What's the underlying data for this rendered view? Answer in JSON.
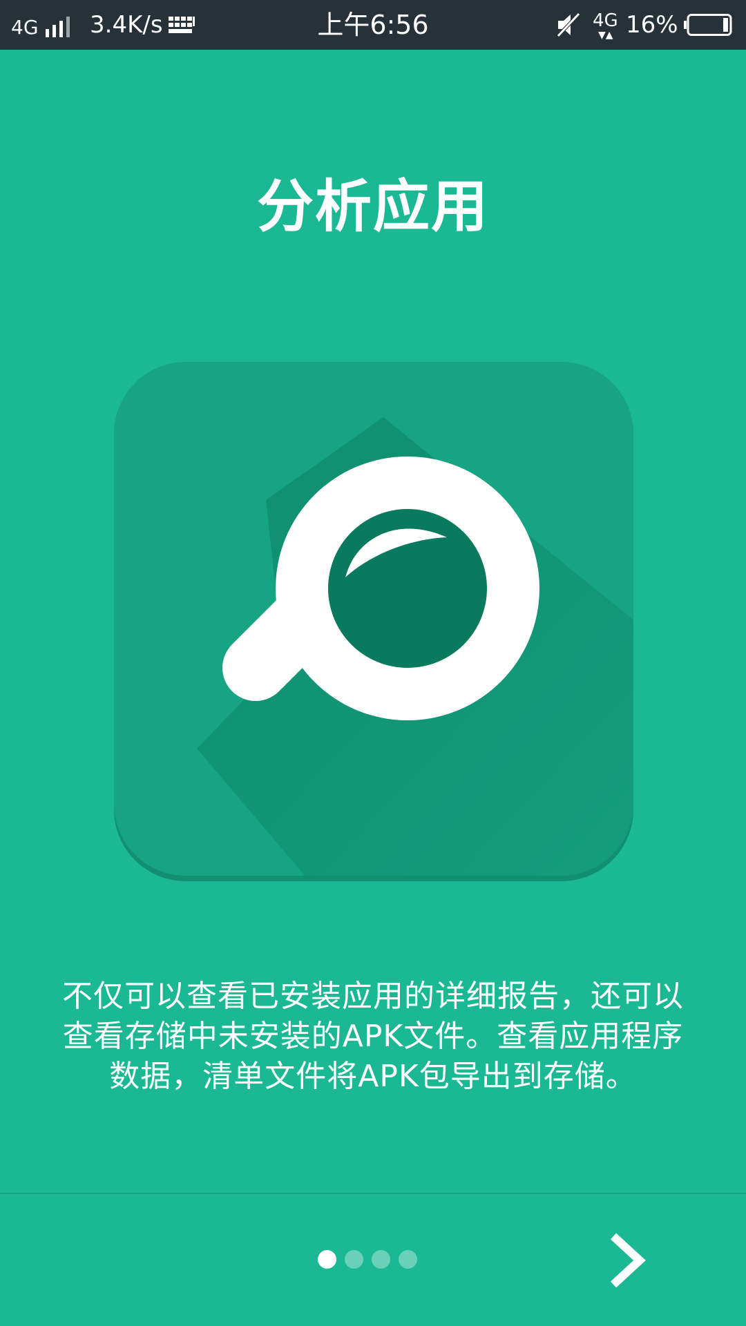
{
  "status_bar": {
    "network_left": "4G",
    "speed": "3.4K/s",
    "time": "上午6:56",
    "network_right": "4G",
    "battery_percent": "16%"
  },
  "intro": {
    "title": "分析应用",
    "description_lines": [
      "不仅可以查看已安装应用的详细报告，还可以",
      "查看存储中未安装的APK文件。查看应用程序",
      "数据，清单文件将APK包导出到存储。"
    ]
  },
  "pager": {
    "total_pages": 4,
    "current_page": 1
  },
  "icons": {
    "hero": "magnifier-icon",
    "next": "chevron-right-icon"
  },
  "colors": {
    "background": "#1bb894",
    "status_bar": "#263238",
    "hero_tile": "#17a482",
    "hero_shadow": "#0e8c6d",
    "lens": "#0a7a5f"
  }
}
